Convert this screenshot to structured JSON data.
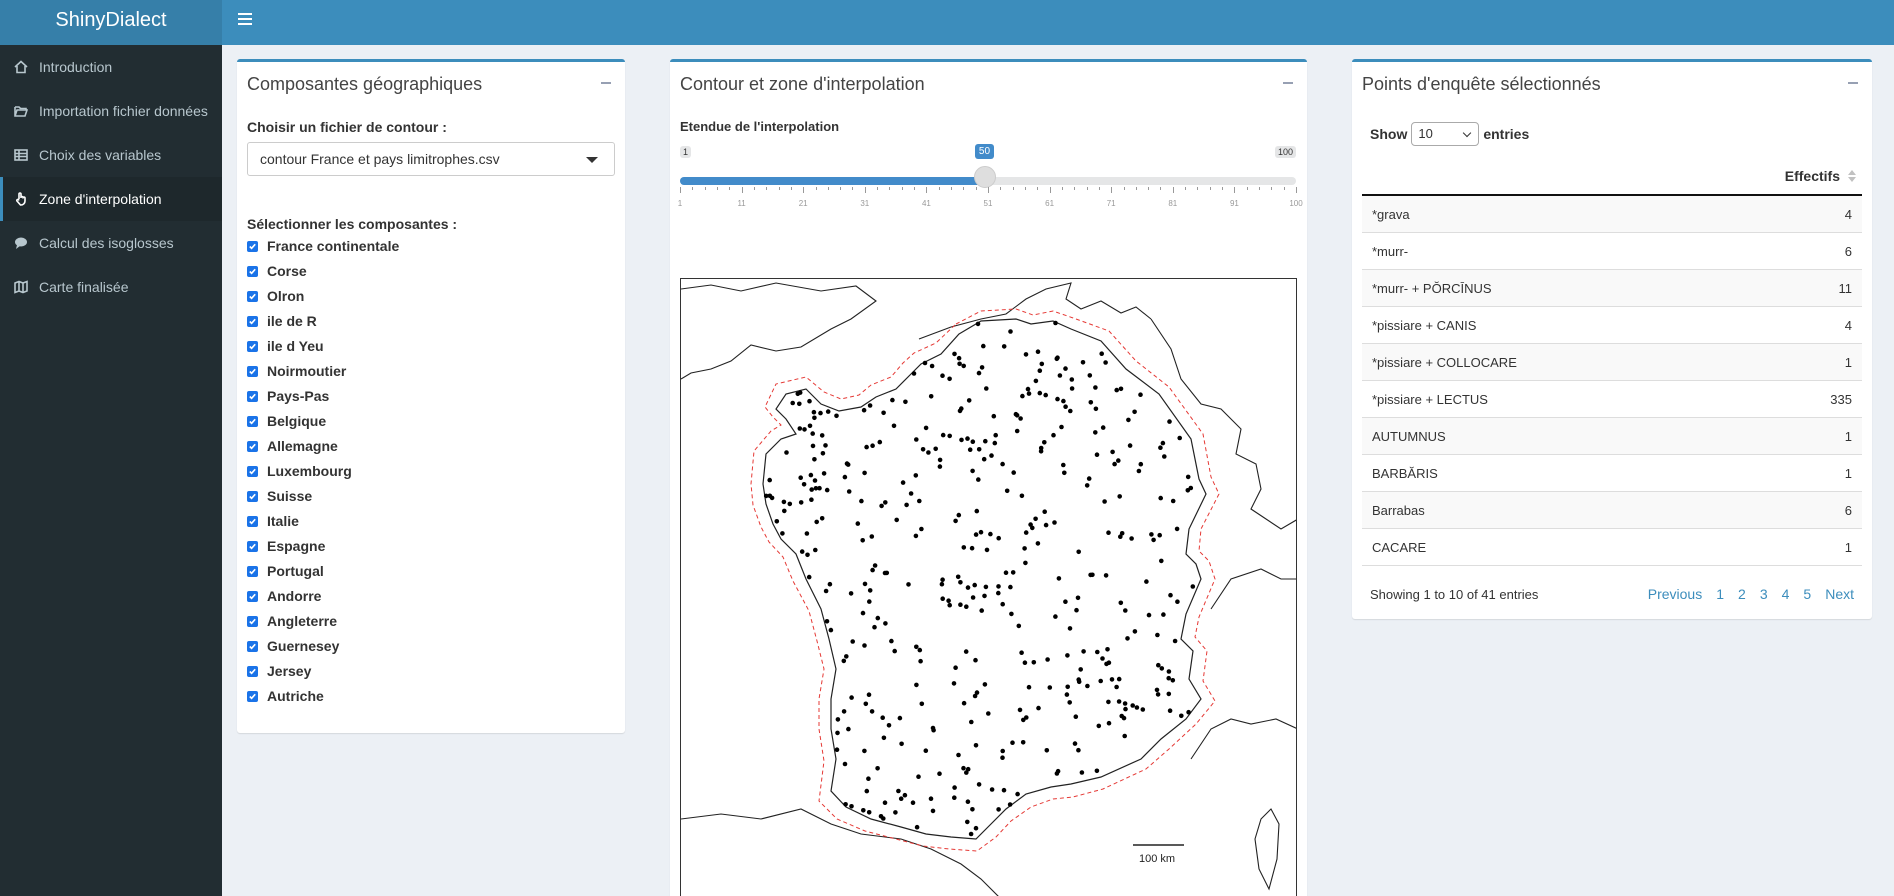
{
  "app": {
    "title": "ShinyDialect"
  },
  "sidebar": {
    "items": [
      {
        "label": "Introduction",
        "icon": "home-icon"
      },
      {
        "label": "Importation fichier données",
        "icon": "folder-open-icon"
      },
      {
        "label": "Choix des variables",
        "icon": "table-icon"
      },
      {
        "label": "Zone d'interpolation",
        "icon": "hand-pointer-icon"
      },
      {
        "label": "Calcul des isoglosses",
        "icon": "comment-icon"
      },
      {
        "label": "Carte finalisée",
        "icon": "map-icon"
      }
    ],
    "active_index": 3
  },
  "geo_box": {
    "title": "Composantes géographiques",
    "contour_label": "Choisir un fichier de contour :",
    "contour_value": "contour France et pays limitrophes.csv",
    "components_label": "Sélectionner les composantes :",
    "components": [
      "France continentale",
      "Corse",
      "Olron",
      "ile de R",
      "ile d Yeu",
      "Noirmoutier",
      "Pays-Pas",
      "Belgique",
      "Allemagne",
      "Luxembourg",
      "Suisse",
      "Italie",
      "Espagne",
      "Portugal",
      "Andorre",
      "Angleterre",
      "Guernesey",
      "Jersey",
      "Autriche"
    ]
  },
  "interp_box": {
    "title": "Contour et zone d'interpolation",
    "slider_label": "Etendue de l'interpolation",
    "slider": {
      "min": "1",
      "max": "100",
      "value": "50",
      "fraction": 0.495
    },
    "ticks": [
      "1",
      "11",
      "21",
      "31",
      "41",
      "51",
      "61",
      "71",
      "81",
      "91",
      "100"
    ],
    "scale_label": "100 km"
  },
  "points_box": {
    "title": "Points d'enquête sélectionnés",
    "show_label": "Show",
    "entries_value": "10",
    "entries_label": "entries",
    "column_header": "Effectifs",
    "rows": [
      {
        "name": "*grava",
        "count": "4"
      },
      {
        "name": "*murr-",
        "count": "6"
      },
      {
        "name": "*murr- + PŎRCĪNUS",
        "count": "11"
      },
      {
        "name": "*pissiare + CANIS",
        "count": "4"
      },
      {
        "name": "*pissiare + COLLOCARE",
        "count": "1"
      },
      {
        "name": "*pissiare + LECTUS",
        "count": "335"
      },
      {
        "name": "AUTUMNUS",
        "count": "1"
      },
      {
        "name": "BARBĂRIS",
        "count": "1"
      },
      {
        "name": "Barrabas",
        "count": "6"
      },
      {
        "name": "CACARE",
        "count": "1"
      }
    ],
    "info": "Showing 1 to 10 of 41 entries",
    "pager": {
      "previous": "Previous",
      "pages": [
        "1",
        "2",
        "3",
        "4",
        "5"
      ],
      "next": "Next"
    }
  },
  "colors": {
    "accent": "#3c8dbc",
    "sidebar": "#222d32",
    "contour_dash": "#e53935"
  }
}
